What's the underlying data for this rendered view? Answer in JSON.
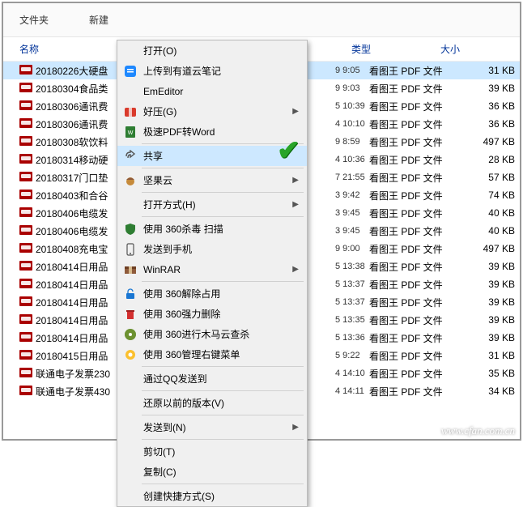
{
  "toolbar": {
    "folder_label": "文件夹",
    "new_label": "新建"
  },
  "columns": {
    "name": "名称",
    "type": "类型",
    "size": "大小"
  },
  "files": [
    {
      "name": "20180226大硬盘",
      "time": "9 9:05",
      "type": "看图王 PDF 文件",
      "size": "31 KB",
      "selected": true
    },
    {
      "name": "20180304食品类",
      "time": "9 9:03",
      "type": "看图王 PDF 文件",
      "size": "39 KB"
    },
    {
      "name": "20180306通讯费",
      "time": "5 10:39",
      "type": "看图王 PDF 文件",
      "size": "36 KB"
    },
    {
      "name": "20180306通讯费",
      "time": "4 10:10",
      "type": "看图王 PDF 文件",
      "size": "36 KB"
    },
    {
      "name": "20180308软饮料",
      "time": "9 8:59",
      "type": "看图王 PDF 文件",
      "size": "497 KB"
    },
    {
      "name": "20180314移动硬",
      "time": "4 10:36",
      "type": "看图王 PDF 文件",
      "size": "28 KB"
    },
    {
      "name": "20180317门口垫",
      "time": "7 21:55",
      "type": "看图王 PDF 文件",
      "size": "57 KB"
    },
    {
      "name": "20180403和合谷",
      "time": "3 9:42",
      "type": "看图王 PDF 文件",
      "size": "74 KB"
    },
    {
      "name": "20180406电缆发",
      "time": "3 9:45",
      "type": "看图王 PDF 文件",
      "size": "40 KB"
    },
    {
      "name": "20180406电缆发",
      "time": "3 9:45",
      "type": "看图王 PDF 文件",
      "size": "40 KB"
    },
    {
      "name": "20180408充电宝",
      "time": "9 9:00",
      "type": "看图王 PDF 文件",
      "size": "497 KB"
    },
    {
      "name": "20180414日用品",
      "time": "5 13:38",
      "type": "看图王 PDF 文件",
      "size": "39 KB"
    },
    {
      "name": "20180414日用品",
      "time": "5 13:37",
      "type": "看图王 PDF 文件",
      "size": "39 KB"
    },
    {
      "name": "20180414日用品",
      "time": "5 13:37",
      "type": "看图王 PDF 文件",
      "size": "39 KB"
    },
    {
      "name": "20180414日用品",
      "time": "5 13:35",
      "type": "看图王 PDF 文件",
      "size": "39 KB"
    },
    {
      "name": "20180414日用品",
      "time": "5 13:36",
      "type": "看图王 PDF 文件",
      "size": "39 KB"
    },
    {
      "name": "20180415日用品",
      "time": "5 9:22",
      "type": "看图王 PDF 文件",
      "size": "31 KB"
    },
    {
      "name": "联通电子发票230",
      "time": "4 14:10",
      "type": "看图王 PDF 文件",
      "size": "35 KB"
    },
    {
      "name": "联通电子发票430",
      "time": "4 14:11",
      "type": "看图王 PDF 文件",
      "size": "34 KB"
    }
  ],
  "menu": {
    "open": "打开(O)",
    "youdao": "上传到有道云笔记",
    "emeditor": "EmEditor",
    "haoya": "好压(G)",
    "pdf2word": "极速PDF转Word",
    "share": "共享",
    "jianguo": "坚果云",
    "openwith": "打开方式(H)",
    "scan360": "使用 360杀毒 扫描",
    "sendphone": "发送到手机",
    "winrar": "WinRAR",
    "unlock360": "使用 360解除占用",
    "forcedel360": "使用 360强力删除",
    "trojan360": "使用 360进行木马云查杀",
    "rclick360": "使用 360管理右键菜单",
    "qqsend": "通过QQ发送到",
    "restore": "还原以前的版本(V)",
    "sendto": "发送到(N)",
    "cut": "剪切(T)",
    "copy": "复制(C)",
    "shortcut": "创建快捷方式(S)"
  },
  "icons": {
    "youdao_color": "#1e88ff",
    "haoya_color": "#d93a2b",
    "pdf2word_color": "#2e7d32",
    "share_color": "#555",
    "nut_color": "#c68a3a",
    "shield_color": "#2e7d32",
    "phone_color": "#555",
    "winrar_color": "#8e5a3a",
    "unlock_color": "#1976d2",
    "trash_color": "#d32f2f",
    "radar_color": "#2e7d32",
    "gear_color": "#fbc02d"
  },
  "watermark": "www.cfan.com.cn"
}
